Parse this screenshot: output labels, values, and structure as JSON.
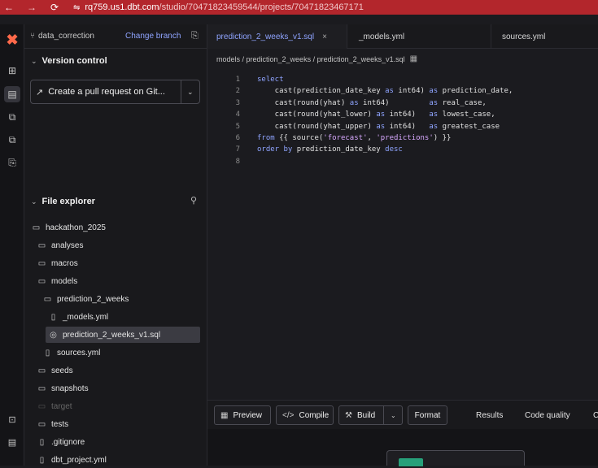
{
  "browser": {
    "back": "←",
    "forward": "→",
    "reload": "⟳",
    "site_settings": "⇋",
    "url_host": "rq759.us1.dbt.com",
    "url_path": "/studio/70471823459544/projects/70471823467171"
  },
  "rail": {
    "logo": "✖",
    "items": [
      "⊞",
      "▤",
      "⧉",
      "⧉",
      "⎘"
    ],
    "bottom": [
      "⊡",
      "▤"
    ]
  },
  "sidebar": {
    "branch_icon": "⑂",
    "branch_name": "data_correction",
    "change_branch": "Change branch",
    "copy_icon": "⎘",
    "version_control": {
      "title": "Version control",
      "chevron": "⌄",
      "pr_icon": "↗",
      "pr_button": "Create a pull request on Git...",
      "dropdown": "⌄"
    },
    "file_explorer": {
      "title": "File explorer",
      "chevron": "⌄",
      "search_icon": "⚲",
      "items": [
        {
          "label": "hackathon_2025",
          "icon": "▭"
        },
        {
          "label": "analyses",
          "icon": "▭"
        },
        {
          "label": "macros",
          "icon": "▭"
        },
        {
          "label": "models",
          "icon": "▭"
        },
        {
          "label": "prediction_2_weeks",
          "icon": "▭"
        },
        {
          "label": "_models.yml",
          "icon": "▯"
        },
        {
          "label": "prediction_2_weeks_v1.sql",
          "icon": "◎"
        },
        {
          "label": "sources.yml",
          "icon": "▯"
        },
        {
          "label": "seeds",
          "icon": "▭"
        },
        {
          "label": "snapshots",
          "icon": "▭"
        },
        {
          "label": "target",
          "icon": "▭"
        },
        {
          "label": "tests",
          "icon": "▭"
        },
        {
          "label": ".gitignore",
          "icon": "▯"
        },
        {
          "label": "dbt_project.yml",
          "icon": "▯"
        }
      ]
    }
  },
  "tabs": [
    {
      "label": "prediction_2_weeks_v1.sql",
      "close": "×"
    },
    {
      "label": "_models.yml"
    },
    {
      "label": "sources.yml"
    }
  ],
  "breadcrumb": {
    "path": "models / prediction_2_weeks / prediction_2_weeks_v1.sql",
    "icon": "▦"
  },
  "editor": {
    "lines": [
      {
        "n": "1",
        "parts": [
          [
            "kw",
            "select"
          ]
        ]
      },
      {
        "n": "2",
        "parts": [
          [
            "fn",
            "    cast(prediction_date_key "
          ],
          [
            "kw",
            "as"
          ],
          [
            "fn",
            " int64) "
          ],
          [
            "kw",
            "as"
          ],
          [
            "fn",
            " prediction_date,"
          ]
        ]
      },
      {
        "n": "3",
        "parts": [
          [
            "fn",
            "    cast(round(yhat) "
          ],
          [
            "kw",
            "as"
          ],
          [
            "fn",
            " int64)         "
          ],
          [
            "kw",
            "as"
          ],
          [
            "fn",
            " real_case,"
          ]
        ]
      },
      {
        "n": "4",
        "parts": [
          [
            "fn",
            "    cast(round(yhat_lower) "
          ],
          [
            "kw",
            "as"
          ],
          [
            "fn",
            " int64)   "
          ],
          [
            "kw",
            "as"
          ],
          [
            "fn",
            " lowest_case,"
          ]
        ]
      },
      {
        "n": "5",
        "parts": [
          [
            "fn",
            "    cast(round(yhat_upper) "
          ],
          [
            "kw",
            "as"
          ],
          [
            "fn",
            " int64)   "
          ],
          [
            "kw",
            "as"
          ],
          [
            "fn",
            " greatest_case"
          ]
        ]
      },
      {
        "n": "6",
        "parts": [
          [
            "kw",
            "from"
          ],
          [
            "fn",
            " {{ source("
          ],
          [
            "str",
            "'forecast'"
          ],
          [
            "fn",
            ", "
          ],
          [
            "str",
            "'predictions'"
          ],
          [
            "fn",
            ") }}"
          ]
        ]
      },
      {
        "n": "7",
        "parts": [
          [
            "kw",
            "order by"
          ],
          [
            "fn",
            " prediction_date_key "
          ],
          [
            "kw",
            "desc"
          ]
        ]
      },
      {
        "n": "8",
        "parts": []
      }
    ]
  },
  "toolbar": {
    "preview_icon": "▦",
    "preview": "Preview",
    "compile_icon": "</>",
    "compile": "Compile",
    "build_icon": "⚒",
    "build": "Build",
    "build_dropdown": "⌄",
    "format": "Format",
    "results": "Results",
    "code_quality": "Code quality",
    "overflow": "C"
  }
}
